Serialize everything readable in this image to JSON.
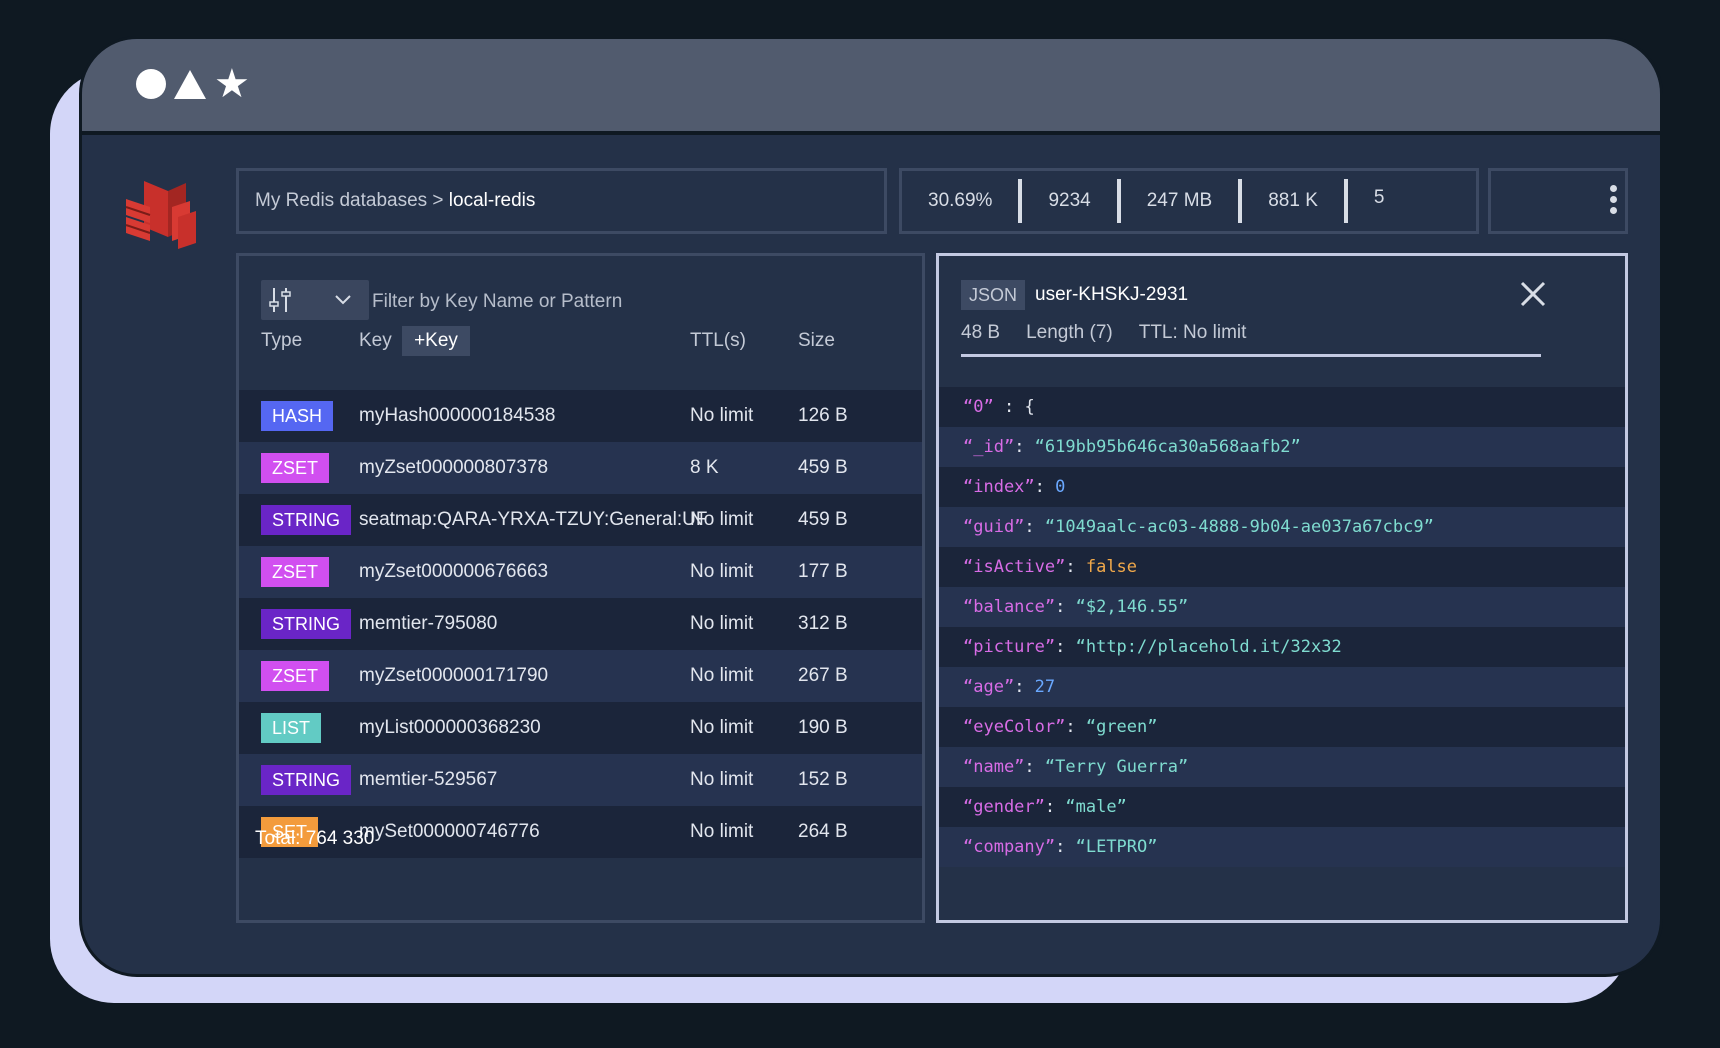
{
  "breadcrumb": {
    "parent": "My Redis databases > ",
    "database": "local-redis"
  },
  "stats": [
    "30.69%",
    "9234",
    "247 MB",
    "881 K",
    "5"
  ],
  "filter": {
    "placeholder": "Filter by Key Name or Pattern"
  },
  "columns": {
    "type": "Type",
    "key": "Key",
    "add_key": "+Key",
    "ttl": "TTL(s)",
    "size": "Size"
  },
  "colors": {
    "hash": "#5567f2",
    "zset": "#d14ff0",
    "string": "#6a25c7",
    "list": "#62cbc4",
    "set": "#f39b3c",
    "accent": "#c3c9e2"
  },
  "rows": [
    {
      "type": "HASH",
      "key": "myHash000000184538",
      "ttl": "No limit",
      "size": "126 B"
    },
    {
      "type": "ZSET",
      "key": "myZset000000807378",
      "ttl": "8 K",
      "size": "459 B"
    },
    {
      "type": "STRING",
      "key": "seatmap:QARA-YRXA-TZUY:General:UF",
      "ttl": "No limit",
      "size": "459 B"
    },
    {
      "type": "ZSET",
      "key": "myZset000000676663",
      "ttl": "No limit",
      "size": "177 B"
    },
    {
      "type": "STRING",
      "key": "memtier-795080",
      "ttl": "No limit",
      "size": "312 B"
    },
    {
      "type": "ZSET",
      "key": "myZset000000171790",
      "ttl": "No limit",
      "size": "267 B"
    },
    {
      "type": "LIST",
      "key": "myList000000368230",
      "ttl": "No limit",
      "size": "190 B"
    },
    {
      "type": "STRING",
      "key": "memtier-529567",
      "ttl": "No limit",
      "size": "152 B"
    },
    {
      "type": "SET",
      "key": "mySet000000746776",
      "ttl": "No limit",
      "size": "264 B"
    }
  ],
  "total": "Total: 764 330",
  "detail": {
    "format": "JSON",
    "key": "user-KHSKJ-2931",
    "size": "48 B",
    "length": "Length (7)",
    "ttl": "TTL: No limit",
    "lines": [
      {
        "k": "“0”",
        "sep": " : ",
        "v": "{",
        "t": "p"
      },
      {
        "k": "“_id”",
        "sep": ": ",
        "v": "“619bb95b646ca30a568aafb2”",
        "t": "s"
      },
      {
        "k": "“index”",
        "sep": ": ",
        "v": "0",
        "t": "n"
      },
      {
        "k": "“guid”",
        "sep": ": ",
        "v": "“1049aalc-ac03-4888-9b04-ae037a67cbc9”",
        "t": "s"
      },
      {
        "k": "“isActive”",
        "sep": ": ",
        "v": "false",
        "t": "b"
      },
      {
        "k": "“balance”",
        "sep": ": ",
        "v": "“$2,146.55”",
        "t": "s"
      },
      {
        "k": "“picture”",
        "sep": ": ",
        "v": "“http://placehold.it/32x32",
        "t": "s"
      },
      {
        "k": "“age”",
        "sep": ": ",
        "v": "27",
        "t": "n"
      },
      {
        "k": "“eyeColor”",
        "sep": ": ",
        "v": "“green”",
        "t": "s"
      },
      {
        "k": "“name”",
        "sep": ": ",
        "v": "“Terry Guerra”",
        "t": "s"
      },
      {
        "k": "“gender”",
        "sep": ": ",
        "v": "“male”",
        "t": "s"
      },
      {
        "k": "“company”",
        "sep": ": ",
        "v": "“LETPRO”",
        "t": "s"
      }
    ]
  }
}
